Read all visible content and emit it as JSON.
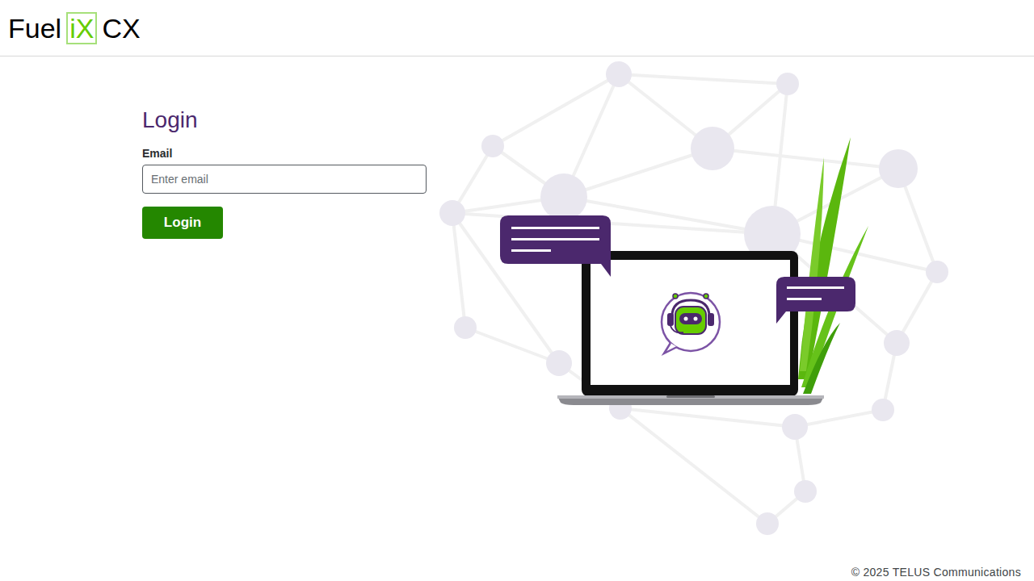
{
  "header": {
    "logo": {
      "prefix": "Fuel",
      "badge": "iX",
      "suffix": "CX"
    }
  },
  "login": {
    "title": "Login",
    "email_label": "Email",
    "email_placeholder": "Enter email",
    "button": "Login"
  },
  "footer": {
    "copyright": "© 2025 TELUS Communications"
  }
}
